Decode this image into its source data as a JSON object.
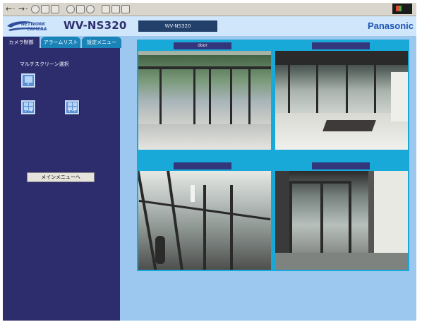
{
  "header": {
    "logo_network": "NETWORK",
    "logo_camera": "CAMERA",
    "model": "WV-NS320",
    "model_box": "WV-NS320",
    "brand": "Panasonic"
  },
  "tabs": [
    {
      "label": "カメラ制御",
      "active": true
    },
    {
      "label": "アラームリスト",
      "active": false
    },
    {
      "label": "設定メニュー",
      "active": false
    }
  ],
  "left_panel": {
    "multi_screen_label": "マルチスクリーン選択",
    "buttons": [
      {
        "id": "1",
        "label": "1"
      },
      {
        "id": "1-4",
        "label": "1〜4"
      },
      {
        "id": "5-8",
        "label": "5〜8"
      }
    ],
    "main_menu_label": "メインメニューへ"
  },
  "cameras": [
    {
      "title": "door"
    },
    {
      "title": ""
    },
    {
      "title": ""
    },
    {
      "title": ""
    }
  ],
  "colors": {
    "background": "#9cc7ef",
    "header_bg": "#cfe6fb",
    "panel_bg": "#2d2d6d",
    "tab_inactive": "#1a84b8",
    "cam_area": "#18a9d8",
    "title_bar": "#33367a",
    "brand_blue": "#1f55b5"
  },
  "icons": {
    "back": "arrow-left-icon",
    "forward": "arrow-right-icon",
    "windows": "windows-logo-icon"
  }
}
